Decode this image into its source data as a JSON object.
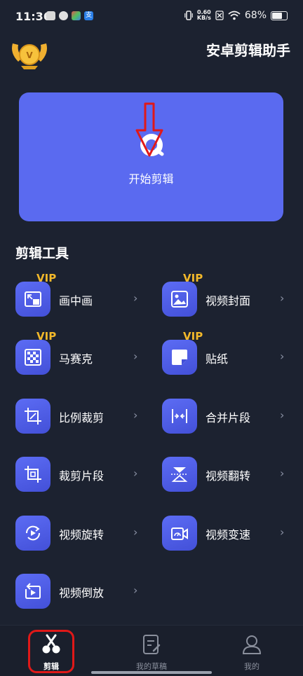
{
  "status_bar": {
    "time": "11:36",
    "net_speed_value": "0.60",
    "net_speed_unit": "KB/s",
    "battery": "68%"
  },
  "header": {
    "title": "安卓剪辑助手",
    "vip_badge_icon": "vip-crown-badge"
  },
  "start_card": {
    "label": "开始剪辑",
    "icon": "video-camera-icon",
    "bg_color": "#5a6af0"
  },
  "section": {
    "title": "剪辑工具"
  },
  "vip_label": "VIP",
  "tools": [
    {
      "label": "画中画",
      "icon": "picture-in-picture-icon",
      "vip": true
    },
    {
      "label": "视频封面",
      "icon": "image-cover-icon",
      "vip": true
    },
    {
      "label": "马赛克",
      "icon": "mosaic-icon",
      "vip": true
    },
    {
      "label": "贴纸",
      "icon": "sticker-icon",
      "vip": true
    },
    {
      "label": "比例裁剪",
      "icon": "ratio-crop-icon",
      "vip": false
    },
    {
      "label": "合并片段",
      "icon": "merge-icon",
      "vip": false
    },
    {
      "label": "裁剪片段",
      "icon": "crop-icon",
      "vip": false
    },
    {
      "label": "视频翻转",
      "icon": "flip-icon",
      "vip": false
    },
    {
      "label": "视频旋转",
      "icon": "rotate-icon",
      "vip": false
    },
    {
      "label": "视频变速",
      "icon": "speed-icon",
      "vip": false
    },
    {
      "label": "视频倒放",
      "icon": "reverse-icon",
      "vip": false
    }
  ],
  "bottom_nav": [
    {
      "label": "剪辑",
      "icon": "scissors-icon",
      "active": true
    },
    {
      "label": "我的草稿",
      "icon": "draft-icon",
      "active": false
    },
    {
      "label": "我的",
      "icon": "user-icon",
      "active": false
    }
  ],
  "colors": {
    "background": "#1c2230",
    "accent": "#5a6af0",
    "vip": "#f2b82a",
    "highlight": "#e01818"
  }
}
